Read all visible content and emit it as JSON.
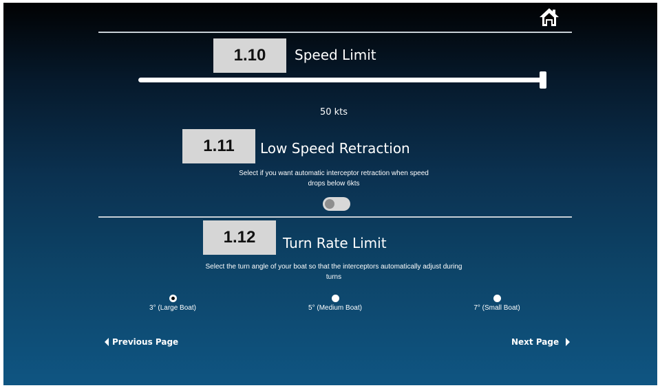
{
  "header": {
    "home_icon": "home-icon"
  },
  "speed_limit": {
    "number": "1.10",
    "title": "Speed Limit",
    "value_display": "50 kts",
    "slider_fraction": 1.0
  },
  "low_speed_retraction": {
    "number": "1.11",
    "title": "Low Speed Retraction",
    "description_line1": "Select if you want automatic interceptor retraction when speed",
    "description_line2": "drops below 6kts",
    "toggle_on": false
  },
  "turn_rate_limit": {
    "number": "1.12",
    "title": "Turn Rate Limit",
    "description_line1": "Select the turn angle of your boat so that the interceptors automatically adjust during",
    "description_line2": "turns",
    "options": [
      {
        "label": "3° (Large Boat)",
        "selected": true
      },
      {
        "label": "5° (Medium Boat)",
        "selected": false
      },
      {
        "label": "7° (Small Boat)",
        "selected": false
      }
    ]
  },
  "navigation": {
    "previous_label": "Previous Page",
    "next_label": "Next Page"
  },
  "colors": {
    "background_top": "#010203",
    "background_bottom": "#0f5582",
    "number_box": "#d6d6d6"
  }
}
